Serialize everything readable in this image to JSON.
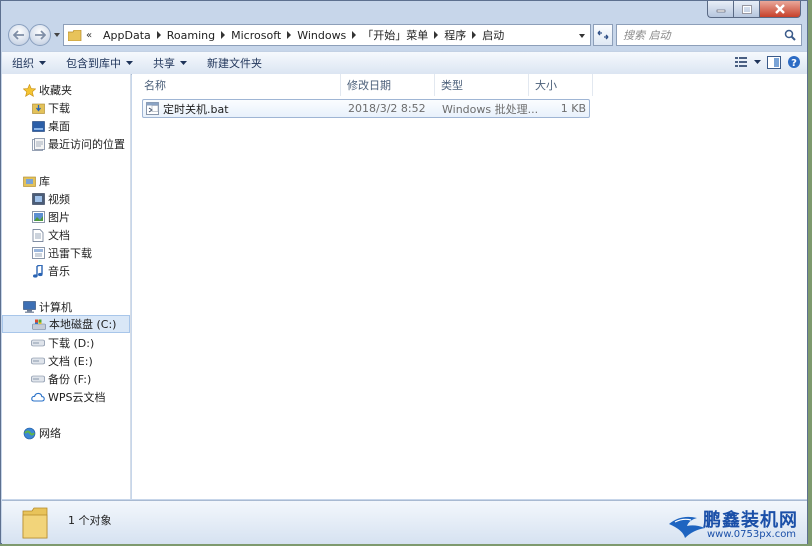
{
  "address": {
    "overflow_chevrons": "«",
    "crumbs": [
      "AppData",
      "Roaming",
      "Microsoft",
      "Windows",
      "「开始」菜单",
      "程序",
      "启动"
    ]
  },
  "search": {
    "placeholder": "搜索 启动"
  },
  "toolbar": {
    "organize": "组织",
    "include_in_library": "包含到库中",
    "share": "共享",
    "new_folder": "新建文件夹"
  },
  "sidebar": {
    "favorites": {
      "label": "收藏夹",
      "items": [
        "下载",
        "桌面",
        "最近访问的位置"
      ]
    },
    "libraries": {
      "label": "库",
      "items": [
        "视频",
        "图片",
        "文档",
        "迅雷下载",
        "音乐"
      ]
    },
    "computer": {
      "label": "计算机",
      "items": [
        "本地磁盘 (C:)",
        "下载 (D:)",
        "文档 (E:)",
        "备份 (F:)",
        "WPS云文档"
      ],
      "selected_index": 0
    },
    "network": {
      "label": "网络"
    }
  },
  "columns": [
    "名称",
    "修改日期",
    "类型",
    "大小"
  ],
  "files": [
    {
      "name": "定时关机.bat",
      "modified": "2018/3/2 8:52",
      "type": "Windows 批处理...",
      "size": "1 KB"
    }
  ],
  "status": {
    "text": "1 个对象"
  },
  "watermark": {
    "brand": "鹏鑫装机网",
    "url": "www.0753px.com"
  },
  "colors": {
    "accent": "#1a4fa8",
    "selection": "#d9e7f7",
    "window_frame": "#c7d6ea"
  }
}
